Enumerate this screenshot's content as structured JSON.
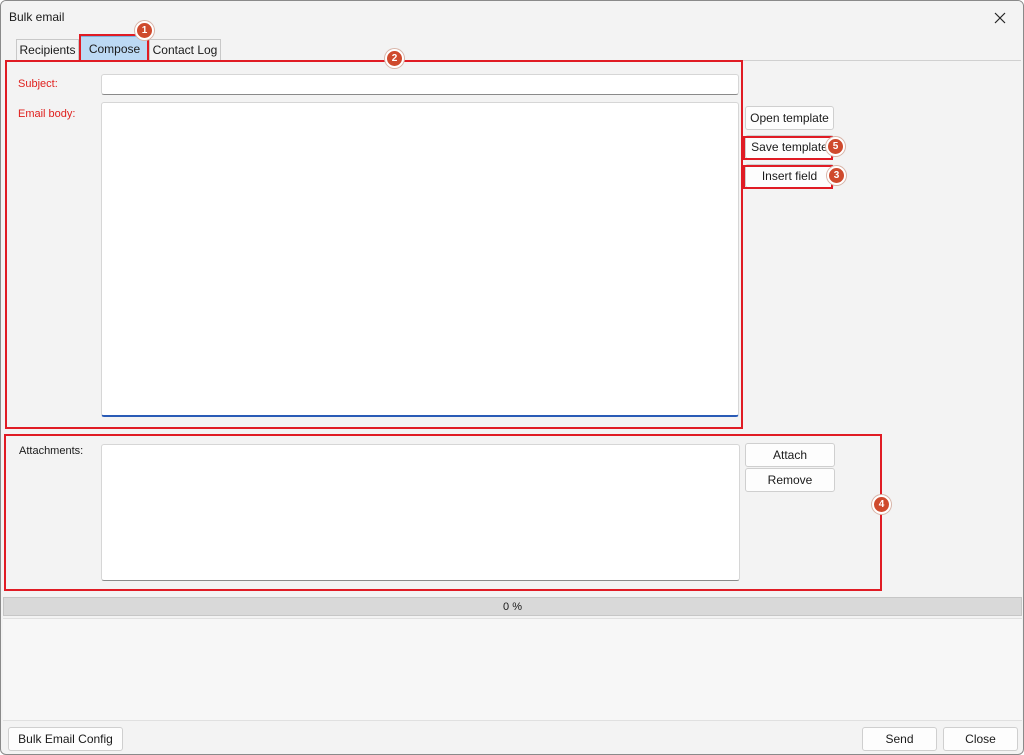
{
  "window": {
    "title": "Bulk email",
    "close_icon": "close-icon"
  },
  "tabs": [
    {
      "label": "Recipients"
    },
    {
      "label": "Compose",
      "active": true
    },
    {
      "label": "Contact Log"
    }
  ],
  "compose": {
    "subject_label": "Subject:",
    "subject_value": "",
    "body_label": "Email body:",
    "body_value": "",
    "buttons": {
      "open_template": "Open template",
      "save_template": "Save template",
      "insert_field": "Insert field"
    }
  },
  "attachments": {
    "label": "Attachments:",
    "attach_button": "Attach",
    "remove_button": "Remove",
    "items": []
  },
  "progress": {
    "text": "0 %",
    "value": 0
  },
  "footer": {
    "config_button": "Bulk Email Config",
    "send_button": "Send",
    "close_button": "Close"
  },
  "annotations": [
    "1",
    "2",
    "3",
    "4",
    "5"
  ],
  "colors": {
    "annotation": "#e01b24",
    "badge": "#cf4a2d",
    "active_tab": "#bcd9f4",
    "required_label": "#e0201e"
  }
}
